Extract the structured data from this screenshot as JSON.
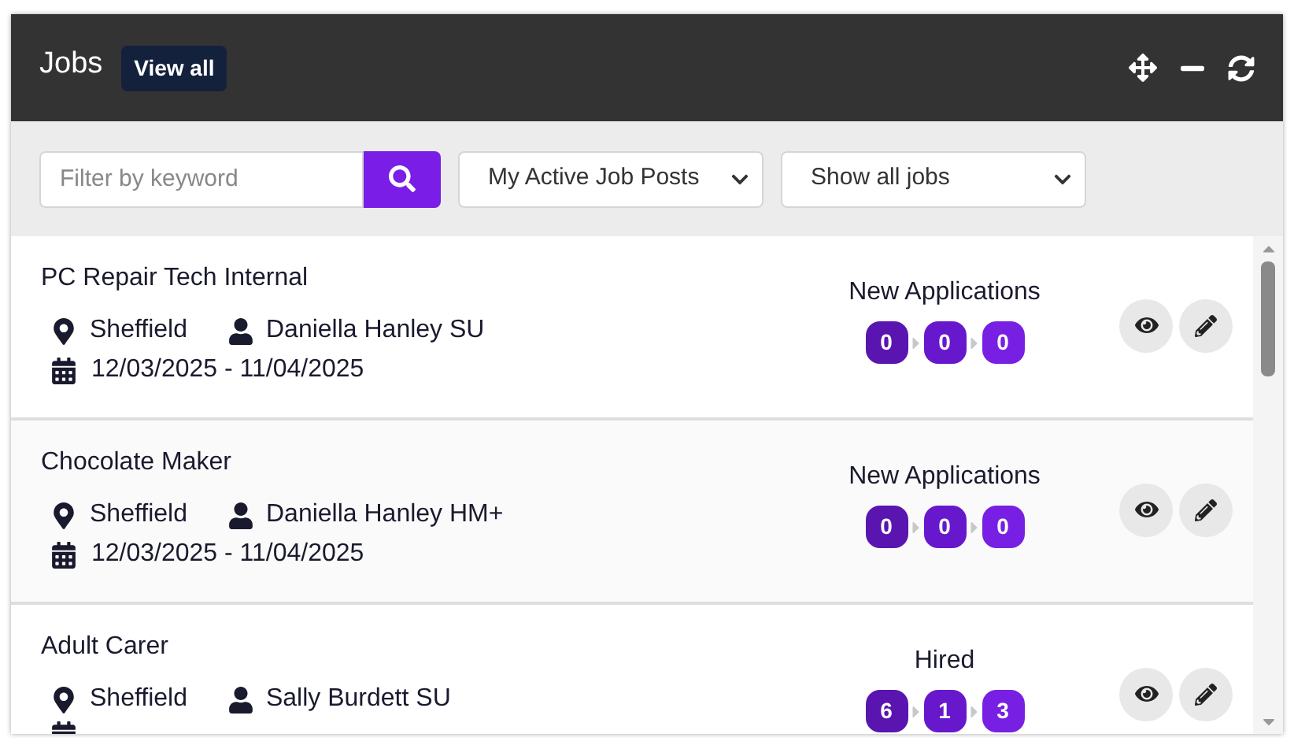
{
  "header": {
    "title": "Jobs",
    "view_all": "View all"
  },
  "filters": {
    "keyword": {
      "placeholder": "Filter by keyword"
    },
    "scope": {
      "value": "My Active Job Posts"
    },
    "status": {
      "value": "Show all jobs"
    }
  },
  "jobs": [
    {
      "title": "PC Repair Tech Internal",
      "location": "Sheffield",
      "owner": "Daniella Hanley SU",
      "dates": "12/03/2025 - 11/04/2025",
      "stage": "New Applications",
      "counts": [
        "0",
        "0",
        "0"
      ]
    },
    {
      "title": "Chocolate Maker",
      "location": "Sheffield",
      "owner": "Daniella Hanley HM+",
      "dates": "12/03/2025 - 11/04/2025",
      "stage": "New Applications",
      "counts": [
        "0",
        "0",
        "0"
      ]
    },
    {
      "title": "Adult Carer",
      "location": "Sheffield",
      "owner": "Sally Burdett SU",
      "stage": "Hired",
      "counts": [
        "6",
        "1",
        "3"
      ]
    }
  ]
}
